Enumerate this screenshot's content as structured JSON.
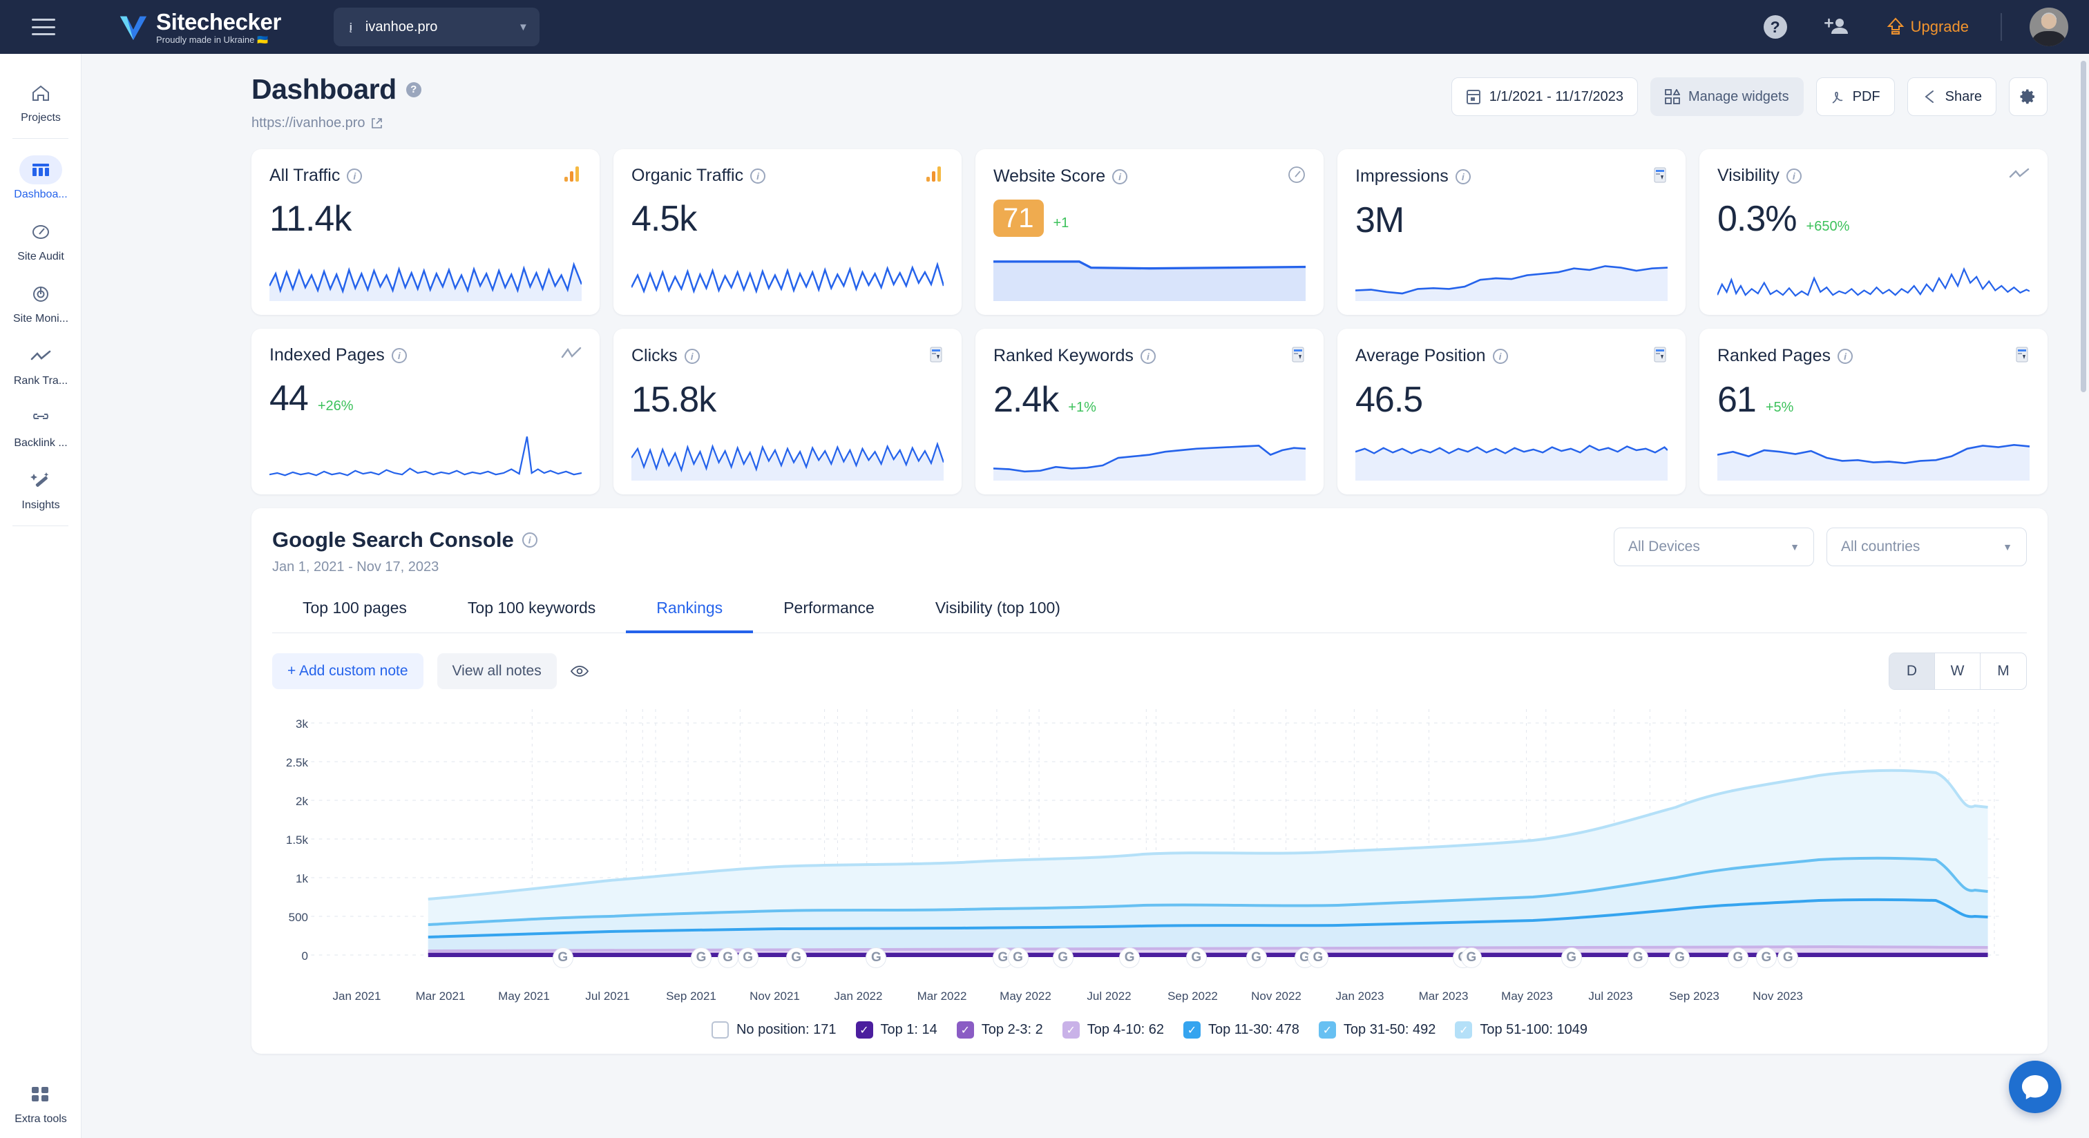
{
  "topbar": {
    "menu_icon": "hamburger-icon",
    "brand_name": "Sitechecker",
    "brand_tagline": "Proudly made in Ukraine 🇺🇦",
    "site_selector": {
      "value": "ivanhoe.pro",
      "favicon": "site-favicon"
    },
    "help_icon": "question-mark-icon",
    "invite_icon": "add-user-icon",
    "upgrade_label": "Upgrade",
    "upgrade_color": "#f2942e",
    "avatar": "user-avatar"
  },
  "sidebar": {
    "items": [
      {
        "label": "Projects",
        "icon": "home-icon",
        "active": false
      },
      {
        "label": "Dashboa...",
        "icon": "dashboard-icon",
        "active": true
      },
      {
        "label": "Site Audit",
        "icon": "gauge-icon",
        "active": false
      },
      {
        "label": "Site Moni...",
        "icon": "radar-icon",
        "active": false
      },
      {
        "label": "Rank Tra...",
        "icon": "trend-line-icon",
        "active": false
      },
      {
        "label": "Backlink ...",
        "icon": "link-icon",
        "active": false
      },
      {
        "label": "Insights",
        "icon": "magic-wand-icon",
        "active": false
      }
    ],
    "footer": {
      "label": "Extra tools",
      "icon": "grid-tools-icon"
    }
  },
  "header": {
    "title": "Dashboard",
    "site_url": "https://ivanhoe.pro",
    "date_range": "1/1/2021 - 11/17/2023",
    "buttons": {
      "manage_widgets": "Manage widgets",
      "pdf": "PDF",
      "share": "Share",
      "settings_icon": "gear-icon"
    }
  },
  "metrics": [
    {
      "title": "All Traffic",
      "value": "11.4k",
      "delta": "",
      "source_icon": "analytics-icon",
      "spark": "noisy"
    },
    {
      "title": "Organic Traffic",
      "value": "4.5k",
      "delta": "",
      "source_icon": "analytics-icon",
      "spark": "noisy"
    },
    {
      "title": "Website Score",
      "value": "71",
      "delta": "+1",
      "source_icon": "gauge-icon",
      "spark": "flat",
      "badge": true,
      "badge_color": "#efab4f"
    },
    {
      "title": "Impressions",
      "value": "3M",
      "delta": "",
      "source_icon": "search-console-icon",
      "spark": "rising"
    },
    {
      "title": "Visibility",
      "value": "0.3%",
      "delta": "+650%",
      "source_icon": "trend-line-icon",
      "spark": "spiky"
    },
    {
      "title": "Indexed Pages",
      "value": "44",
      "delta": "+26%",
      "source_icon": "trend-line-icon",
      "spark": "lowspike"
    },
    {
      "title": "Clicks",
      "value": "15.8k",
      "delta": "",
      "source_icon": "search-console-icon",
      "spark": "noisy"
    },
    {
      "title": "Ranked Keywords",
      "value": "2.4k",
      "delta": "+1%",
      "source_icon": "search-console-icon",
      "spark": "rising"
    },
    {
      "title": "Average Position",
      "value": "46.5",
      "delta": "",
      "source_icon": "search-console-icon",
      "spark": "flat2"
    },
    {
      "title": "Ranked Pages",
      "value": "61",
      "delta": "+5%",
      "source_icon": "search-console-icon",
      "spark": "wave"
    }
  ],
  "gsc": {
    "title": "Google Search Console",
    "subtitle": "Jan 1, 2021 - Nov 17, 2023",
    "device_filter": "All Devices",
    "country_filter": "All countries",
    "tabs": [
      {
        "label": "Top 100 pages",
        "active": false
      },
      {
        "label": "Top 100 keywords",
        "active": false
      },
      {
        "label": "Rankings",
        "active": true
      },
      {
        "label": "Performance",
        "active": false
      },
      {
        "label": "Visibility (top 100)",
        "active": false
      }
    ],
    "notes": {
      "add_label": "+ Add custom note",
      "view_label": "View all notes",
      "eye_icon": "eye-icon"
    },
    "granularity": [
      {
        "label": "D",
        "active": true
      },
      {
        "label": "W",
        "active": false
      },
      {
        "label": "M",
        "active": false
      }
    ]
  },
  "chart_data": {
    "type": "area",
    "title": "Rankings",
    "xlabel": "",
    "ylabel": "",
    "ylim": [
      0,
      3000
    ],
    "yticks": [
      "0",
      "500",
      "1k",
      "1.5k",
      "2k",
      "2.5k",
      "3k"
    ],
    "ytick_values": [
      0,
      500,
      1000,
      1500,
      2000,
      2500,
      3000
    ],
    "grid": true,
    "legend_position": "bottom",
    "x": [
      "Jan 2021",
      "Mar 2021",
      "May 2021",
      "Jul 2021",
      "Sep 2021",
      "Nov 2021",
      "Jan 2022",
      "Mar 2022",
      "May 2022",
      "Jul 2022",
      "Sep 2022",
      "Nov 2022",
      "Jan 2023",
      "Mar 2023",
      "May 2023",
      "Jul 2023",
      "Sep 2023",
      "Nov 2023"
    ],
    "series": [
      {
        "name": "No position: 171",
        "label": "No position",
        "total": 171,
        "color": "#ffffff",
        "checked": false,
        "values": [
          0,
          0,
          0,
          0,
          0,
          0,
          0,
          0,
          0,
          0,
          0,
          0,
          0,
          0,
          0,
          0,
          0,
          0
        ]
      },
      {
        "name": "Top 1: 14",
        "label": "Top 1",
        "total": 14,
        "color": "#4b1e9e",
        "checked": true,
        "values": [
          4,
          5,
          5,
          6,
          6,
          7,
          7,
          8,
          8,
          8,
          9,
          9,
          10,
          11,
          12,
          13,
          14,
          14
        ]
      },
      {
        "name": "Top 2-3: 2",
        "label": "Top 2-3",
        "total": 2,
        "color": "#8a5cc4",
        "checked": true,
        "values": [
          2,
          2,
          2,
          2,
          2,
          2,
          2,
          2,
          2,
          2,
          2,
          2,
          2,
          2,
          2,
          2,
          2,
          2
        ]
      },
      {
        "name": "Top 4-10: 62",
        "label": "Top 4-10",
        "total": 62,
        "color": "#c9b2e8",
        "checked": true,
        "values": [
          20,
          24,
          26,
          28,
          30,
          32,
          34,
          36,
          34,
          36,
          38,
          40,
          42,
          46,
          52,
          58,
          60,
          62
        ]
      },
      {
        "name": "Top 11-30: 478",
        "label": "Top 11-30",
        "total": 478,
        "color": "#35a4ef",
        "checked": true,
        "values": [
          150,
          165,
          180,
          195,
          205,
          215,
          225,
          235,
          230,
          240,
          250,
          265,
          280,
          300,
          380,
          470,
          500,
          478
        ]
      },
      {
        "name": "Top 31-50: 492",
        "label": "Top 31-50",
        "total": 492,
        "color": "#67c0f2",
        "checked": true,
        "values": [
          270,
          300,
          330,
          360,
          380,
          400,
          415,
          430,
          420,
          435,
          450,
          470,
          495,
          530,
          690,
          860,
          920,
          492
        ]
      },
      {
        "name": "Top 51-100: 1049",
        "label": "Top 51-100",
        "total": 1049,
        "color": "#b4e0f8",
        "checked": true,
        "values": [
          560,
          620,
          680,
          740,
          790,
          830,
          870,
          900,
          880,
          910,
          950,
          990,
          1040,
          1120,
          1500,
          2050,
          2400,
          1049
        ]
      }
    ],
    "annotations": [
      {
        "type": "google-update-marker",
        "label": "G",
        "x_positions": [
          0.145,
          0.228,
          0.244,
          0.256,
          0.285,
          0.333,
          0.409,
          0.418,
          0.445,
          0.485,
          0.525,
          0.561,
          0.59,
          0.598,
          0.685,
          0.69,
          0.75,
          0.79,
          0.815,
          0.85,
          0.867,
          0.88
        ]
      }
    ]
  },
  "widgets": {
    "intercom_icon": "chat-icon"
  }
}
